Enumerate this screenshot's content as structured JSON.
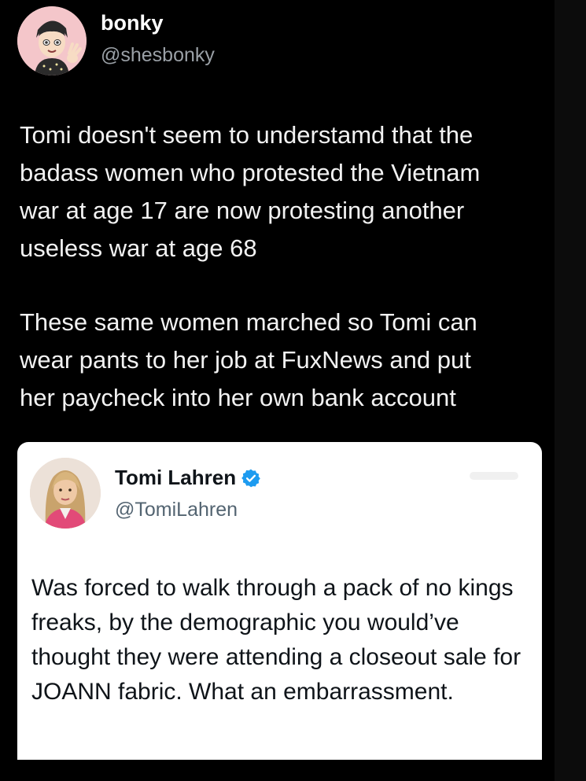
{
  "post": {
    "display_name": "bonky",
    "handle": "@shesbonky",
    "paragraphs": [
      "Tomi doesn't seem to understamd that the\nbadass women who protested the Vietnam\nwar at age 17 are now protesting another\nuseless war at age 68",
      "These same women marched so Tomi can\nwear pants to her job at FuxNews and put\nher paycheck into her own bank account"
    ]
  },
  "quoted_post": {
    "display_name": "Tomi Lahren",
    "handle": "@TomiLahren",
    "verified": true,
    "text": "Was forced to walk through a pack of no kings freaks, by the demographic you would’ve thought they were attending a closeout sale for JOANN fabric. What an embarrassment."
  },
  "colors": {
    "background": "#000000",
    "card_background": "#ffffff",
    "verified_badge": "#1d9bf0",
    "secondary_text": "#9aa0a6"
  },
  "icons": {
    "author_avatar": "cartoon-avatar-icon",
    "quoted_avatar": "profile-photo-icon",
    "verified": "verified-badge-icon"
  }
}
